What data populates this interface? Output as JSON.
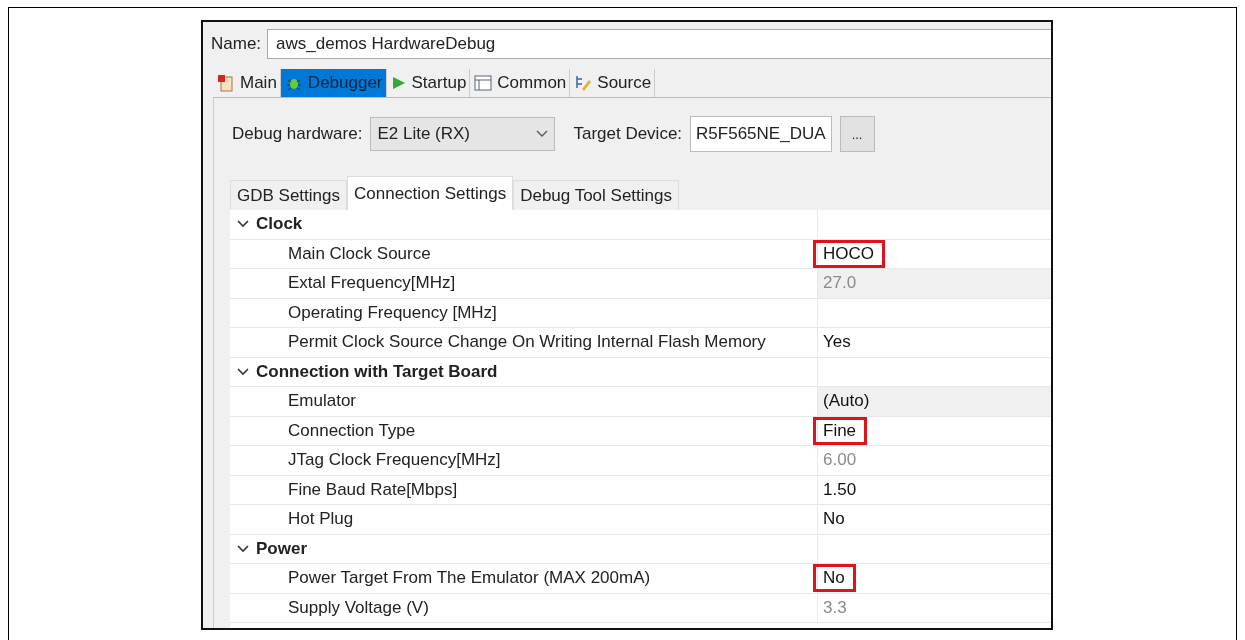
{
  "name_field": {
    "label": "Name:",
    "value": "aws_demos HardwareDebug"
  },
  "tabs": [
    {
      "label": "Main",
      "kind": "main",
      "selected": false
    },
    {
      "label": "Debugger",
      "kind": "debugger",
      "selected": true
    },
    {
      "label": "Startup",
      "kind": "startup",
      "selected": false
    },
    {
      "label": "Common",
      "kind": "common",
      "selected": false
    },
    {
      "label": "Source",
      "kind": "source",
      "selected": false
    }
  ],
  "debug_hardware": {
    "label": "Debug hardware:",
    "value": "E2 Lite (RX)"
  },
  "target_device": {
    "label": "Target Device:",
    "value": "R5F565NE_DUA",
    "button": "..."
  },
  "sub_tabs": [
    {
      "label": "GDB Settings",
      "selected": false
    },
    {
      "label": "Connection Settings",
      "selected": true
    },
    {
      "label": "Debug Tool Settings",
      "selected": false
    }
  ],
  "groups": [
    {
      "title": "Clock",
      "expanded": true,
      "rows": [
        {
          "name": "Main Clock Source",
          "value": "HOCO",
          "highlighted": true,
          "readonly": false,
          "shaded": false
        },
        {
          "name": "Extal Frequency[MHz]",
          "value": "27.0",
          "highlighted": false,
          "readonly": true,
          "shaded": true
        },
        {
          "name": "Operating Frequency [MHz]",
          "shaded": false
        },
        {
          "name": "Permit Clock Source Change On Writing Internal Flash Memory",
          "value": "Yes",
          "highlighted": false,
          "readonly": false,
          "shaded": false
        }
      ]
    },
    {
      "title": "Connection with Target Board",
      "expanded": true,
      "rows": [
        {
          "name": "Emulator",
          "value": "(Auto)",
          "highlighted": false,
          "readonly": false,
          "shaded": true
        },
        {
          "name": "Connection Type",
          "value": "Fine",
          "highlighted": true,
          "readonly": false,
          "shaded": false
        },
        {
          "name": "JTag Clock Frequency[MHz]",
          "value": "6.00",
          "highlighted": false,
          "readonly": true,
          "shaded": false
        },
        {
          "name": "Fine Baud Rate[Mbps]",
          "value": "1.50",
          "highlighted": false,
          "readonly": false,
          "shaded": false
        },
        {
          "name": "Hot Plug",
          "value": "No",
          "highlighted": false,
          "readonly": false,
          "shaded": false
        }
      ]
    },
    {
      "title": "Power",
      "expanded": true,
      "rows": [
        {
          "name": "Power Target From The Emulator (MAX 200mA)",
          "value": "No",
          "highlighted": true,
          "readonly": false,
          "shaded": false
        },
        {
          "name": "Supply Voltage (V)",
          "value": "3.3",
          "highlighted": false,
          "readonly": true,
          "shaded": false
        }
      ]
    }
  ]
}
